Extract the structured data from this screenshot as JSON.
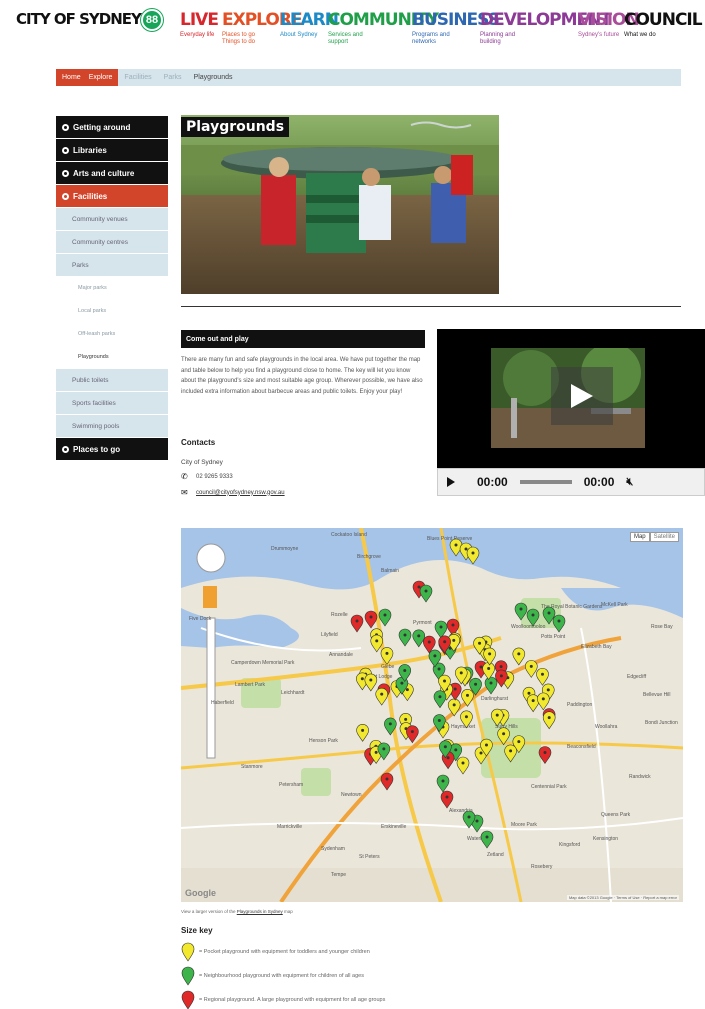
{
  "header": {
    "logo_text": "CITY OF SYDNEY",
    "logo_badge": "88",
    "nav": [
      {
        "label": "LIVE",
        "sub": "Everyday life",
        "color": "#d7262c"
      },
      {
        "label": "EXPLORE",
        "sub": "Places to go Things to do",
        "color": "#e35025"
      },
      {
        "label": "LEARN",
        "sub": "About Sydney",
        "color": "#1b8ac6"
      },
      {
        "label": "COMMUNITY",
        "sub": "Services and support",
        "color": "#1e9f48"
      },
      {
        "label": "BUSINESS",
        "sub": "Programs and networks",
        "color": "#2e67b1"
      },
      {
        "label": "DEVELOPMENT",
        "sub": "Planning and building",
        "color": "#8c3a96"
      },
      {
        "label": "VISION",
        "sub": "Sydney's future",
        "color": "#a94c9a"
      },
      {
        "label": "COUNCIL",
        "sub": "What we do",
        "color": "#111111"
      }
    ]
  },
  "breadcrumb": {
    "items": [
      "Home",
      "Explore",
      "Facilities",
      "Parks",
      "Playgrounds"
    ]
  },
  "sidebar": {
    "items": [
      {
        "label": "Getting around",
        "level": 0
      },
      {
        "label": "Libraries",
        "level": 0
      },
      {
        "label": "Arts and culture",
        "level": 0
      },
      {
        "label": "Facilities",
        "level": 0,
        "active": true
      },
      {
        "label": "Community venues",
        "level": 1
      },
      {
        "label": "Community centres",
        "level": 1
      },
      {
        "label": "Parks",
        "level": 1
      },
      {
        "label": "Major parks",
        "level": 2
      },
      {
        "label": "Local parks",
        "level": 2
      },
      {
        "label": "Off-leash parks",
        "level": 2
      },
      {
        "label": "Playgrounds",
        "level": 2,
        "current": true
      },
      {
        "label": "Public toilets",
        "level": 1
      },
      {
        "label": "Sports facilities",
        "level": 1
      },
      {
        "label": "Swimming pools",
        "level": 1
      },
      {
        "label": "Places to go",
        "level": 0
      }
    ]
  },
  "page": {
    "title": "Playgrounds",
    "section_heading": "Come out and play",
    "intro": "There are many fun and safe playgrounds in the local area. We have put together the map and table below to help you find a playground close to home. The key will let you know about the playground's size and most suitable age group. Wherever possible, we have also included extra information about barbecue areas and public toilets. Enjoy your play!",
    "contacts_heading": "Contacts",
    "contact_name": "City of Sydney",
    "phone": "02 9265 9333",
    "email": "council@cityofsydney.nsw.gov.au"
  },
  "video": {
    "time_current": "00:00",
    "time_total": "00:00"
  },
  "map": {
    "type_map": "Map",
    "type_satellite": "Satellite",
    "labels": [
      "Cockatoo Island",
      "Blues Point Reserve",
      "Drummoyne",
      "Balmain",
      "Birchgrove",
      "Lilyfield",
      "Leichhardt",
      "Annandale",
      "Lambert Park",
      "Petersham",
      "Marrickville",
      "Newtown",
      "St Peters",
      "Alexandria",
      "Surry Hills",
      "Paddington",
      "Woollahra",
      "Kingsford",
      "Randwick",
      "Centennial Park",
      "Camperdown Memorial Park",
      "Five Dock",
      "McKell Park",
      "Elizabeth Bay",
      "Edgecliff",
      "Bondi Junction",
      "Tempe",
      "Queens Park",
      "Erskineville",
      "Rozelle",
      "Forest Lodge",
      "Glebe",
      "Kensington",
      "Moore Park",
      "Waterloo",
      "Zetland",
      "Darlinghurst",
      "Pyrmont",
      "Haymarket",
      "Potts Point",
      "Woolloomooloo",
      "The Royal Botanic Gardens",
      "Henson Park",
      "Rose Bay",
      "Bellevue Hill",
      "Beaconsfield",
      "Rosebery",
      "Sydenham",
      "Haberfield",
      "Stanmore"
    ],
    "footer": "Map data ©2013 Google · Terms of Use · Report a map error",
    "google_mark": "Google",
    "caption_prefix": "View a larger version of the",
    "caption_link": "Playgrounds in Sydney",
    "caption_suffix": "map"
  },
  "size_key": {
    "heading": "Size key",
    "items": [
      {
        "color": "#f2e92e",
        "text": "= Pocket playground with equipment for toddlers and younger children"
      },
      {
        "color": "#3db54a",
        "text": "= Neighbourhood playground with equipment for children of all ages"
      },
      {
        "color": "#e02a2a",
        "text": "= Regional playground. A large playground with equipment for all age groups"
      }
    ]
  },
  "icons": {
    "phone": "phone-icon",
    "email": "email-icon",
    "bullet": "circle-bullet-icon",
    "play": "play-icon",
    "mute": "mute-icon",
    "pan": "pan-control-icon",
    "pegman": "pegman-icon"
  }
}
